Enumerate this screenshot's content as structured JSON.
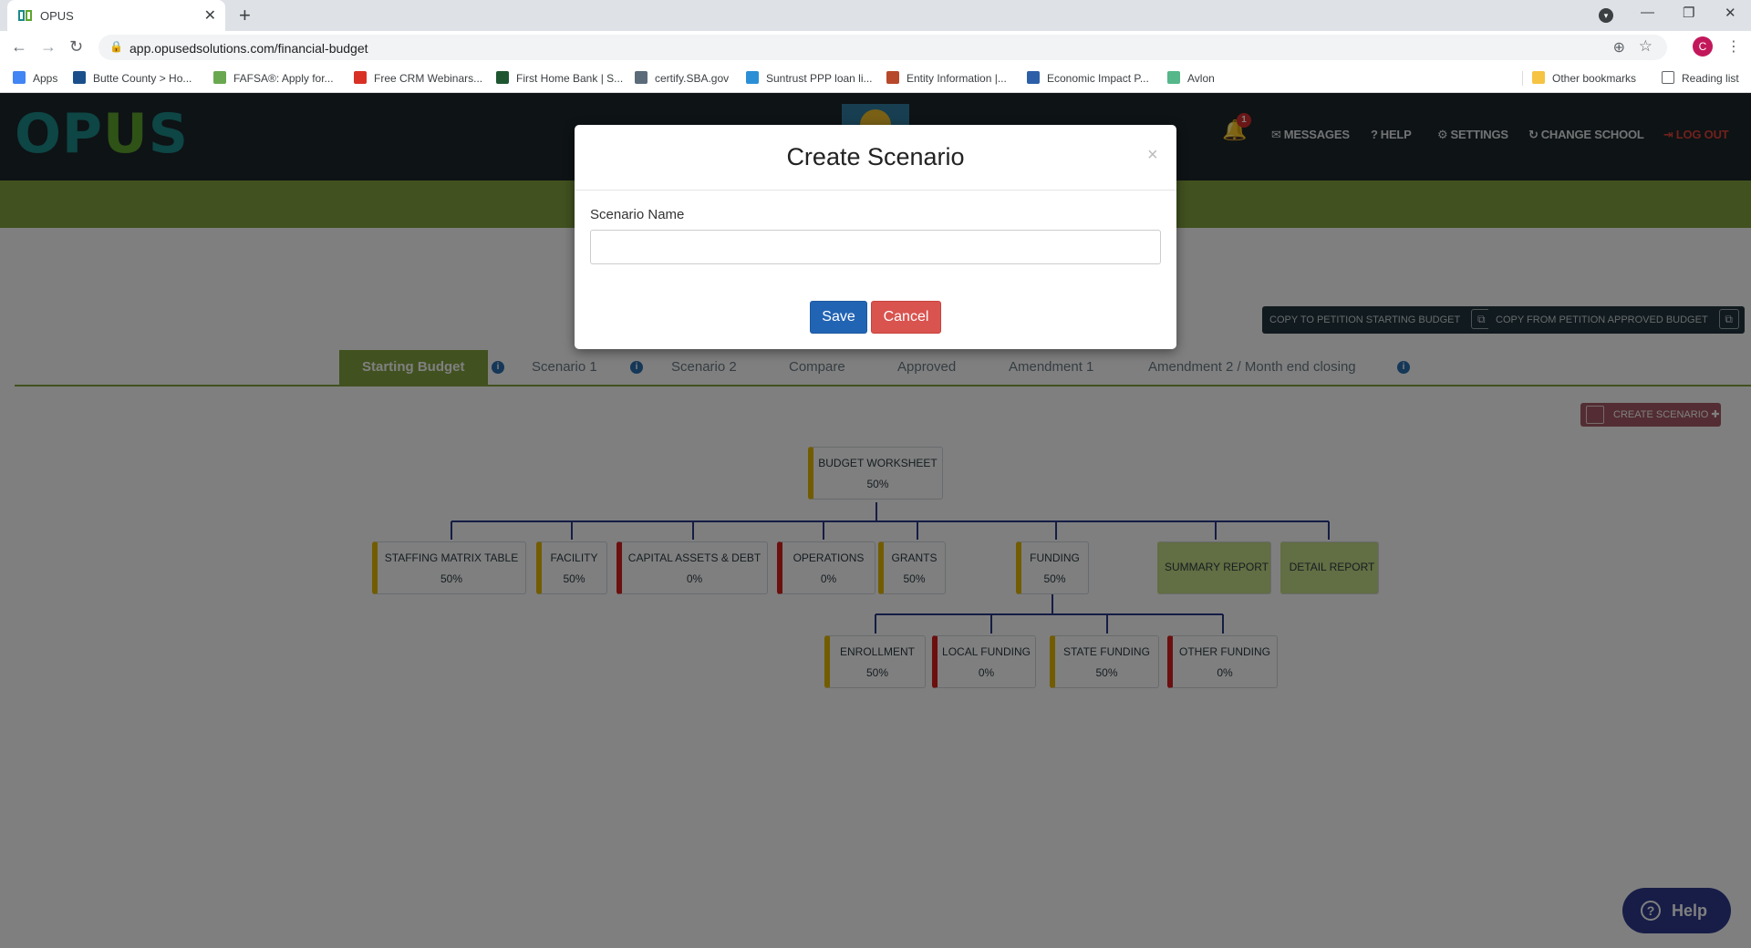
{
  "browser": {
    "tab_title": "OPUS",
    "url": "app.opusedsolutions.com/financial-budget",
    "profile_initial": "C",
    "bookmarks": [
      {
        "label": "Apps",
        "color": "#4285f4"
      },
      {
        "label": "Butte County > Ho...",
        "color": "#1a4f8b"
      },
      {
        "label": "FAFSA®: Apply for...",
        "color": "#6aa84f"
      },
      {
        "label": "Free CRM Webinars...",
        "color": "#d93025"
      },
      {
        "label": "First Home Bank | S...",
        "color": "#1e5631"
      },
      {
        "label": "certify.SBA.gov",
        "color": "#5b6b7a"
      },
      {
        "label": "Suntrust PPP loan li...",
        "color": "#2b8fd6"
      },
      {
        "label": "Entity Information |...",
        "color": "#b8482b"
      },
      {
        "label": "Economic Impact P...",
        "color": "#2d5fa8"
      },
      {
        "label": "Avlon",
        "color": "#55b78a"
      }
    ],
    "other_bookmarks": "Other bookmarks",
    "reading_list": "Reading list"
  },
  "header": {
    "logo_left": "OP",
    "logo_u": "U",
    "logo_right": "S",
    "notifications_count": "1",
    "nav": {
      "messages": "MESSAGES",
      "help": "HELP",
      "settings": "SETTINGS",
      "change_school": "CHANGE SCHOOL",
      "logout": "LOG OUT"
    }
  },
  "actions": {
    "copy_to_petition": "COPY TO PETITION STARTING BUDGET",
    "copy_from_petition": "COPY FROM PETITION APPROVED BUDGET",
    "create_scenario": "CREATE SCENARIO"
  },
  "tabs": [
    "Starting Budget",
    "Scenario 1",
    "Scenario 2",
    "Compare",
    "Approved",
    "Amendment 1",
    "Amendment 2 / Month end closing"
  ],
  "tree": {
    "root": {
      "label": "BUDGET WORKSHEET",
      "pct": "50%"
    },
    "level1": [
      {
        "label": "STAFFING MATRIX TABLE",
        "pct": "50%",
        "status": "yellow"
      },
      {
        "label": "FACILITY",
        "pct": "50%",
        "status": "yellow"
      },
      {
        "label": "CAPITAL ASSETS & DEBT",
        "pct": "0%",
        "status": "red"
      },
      {
        "label": "OPERATIONS",
        "pct": "0%",
        "status": "red"
      },
      {
        "label": "GRANTS",
        "pct": "50%",
        "status": "yellow"
      },
      {
        "label": "FUNDING",
        "pct": "50%",
        "status": "yellow"
      },
      {
        "label": "SUMMARY REPORT",
        "pct": "",
        "status": "green"
      },
      {
        "label": "DETAIL REPORT",
        "pct": "",
        "status": "green"
      }
    ],
    "level2": [
      {
        "label": "ENROLLMENT",
        "pct": "50%",
        "status": "yellow"
      },
      {
        "label": "LOCAL FUNDING",
        "pct": "0%",
        "status": "red"
      },
      {
        "label": "STATE FUNDING",
        "pct": "50%",
        "status": "yellow"
      },
      {
        "label": "OTHER FUNDING",
        "pct": "0%",
        "status": "red"
      }
    ]
  },
  "help_button": "Help",
  "modal": {
    "title": "Create Scenario",
    "close": "×",
    "field_label": "Scenario Name",
    "field_value": "",
    "field_placeholder": "",
    "save": "Save",
    "cancel": "Cancel"
  }
}
